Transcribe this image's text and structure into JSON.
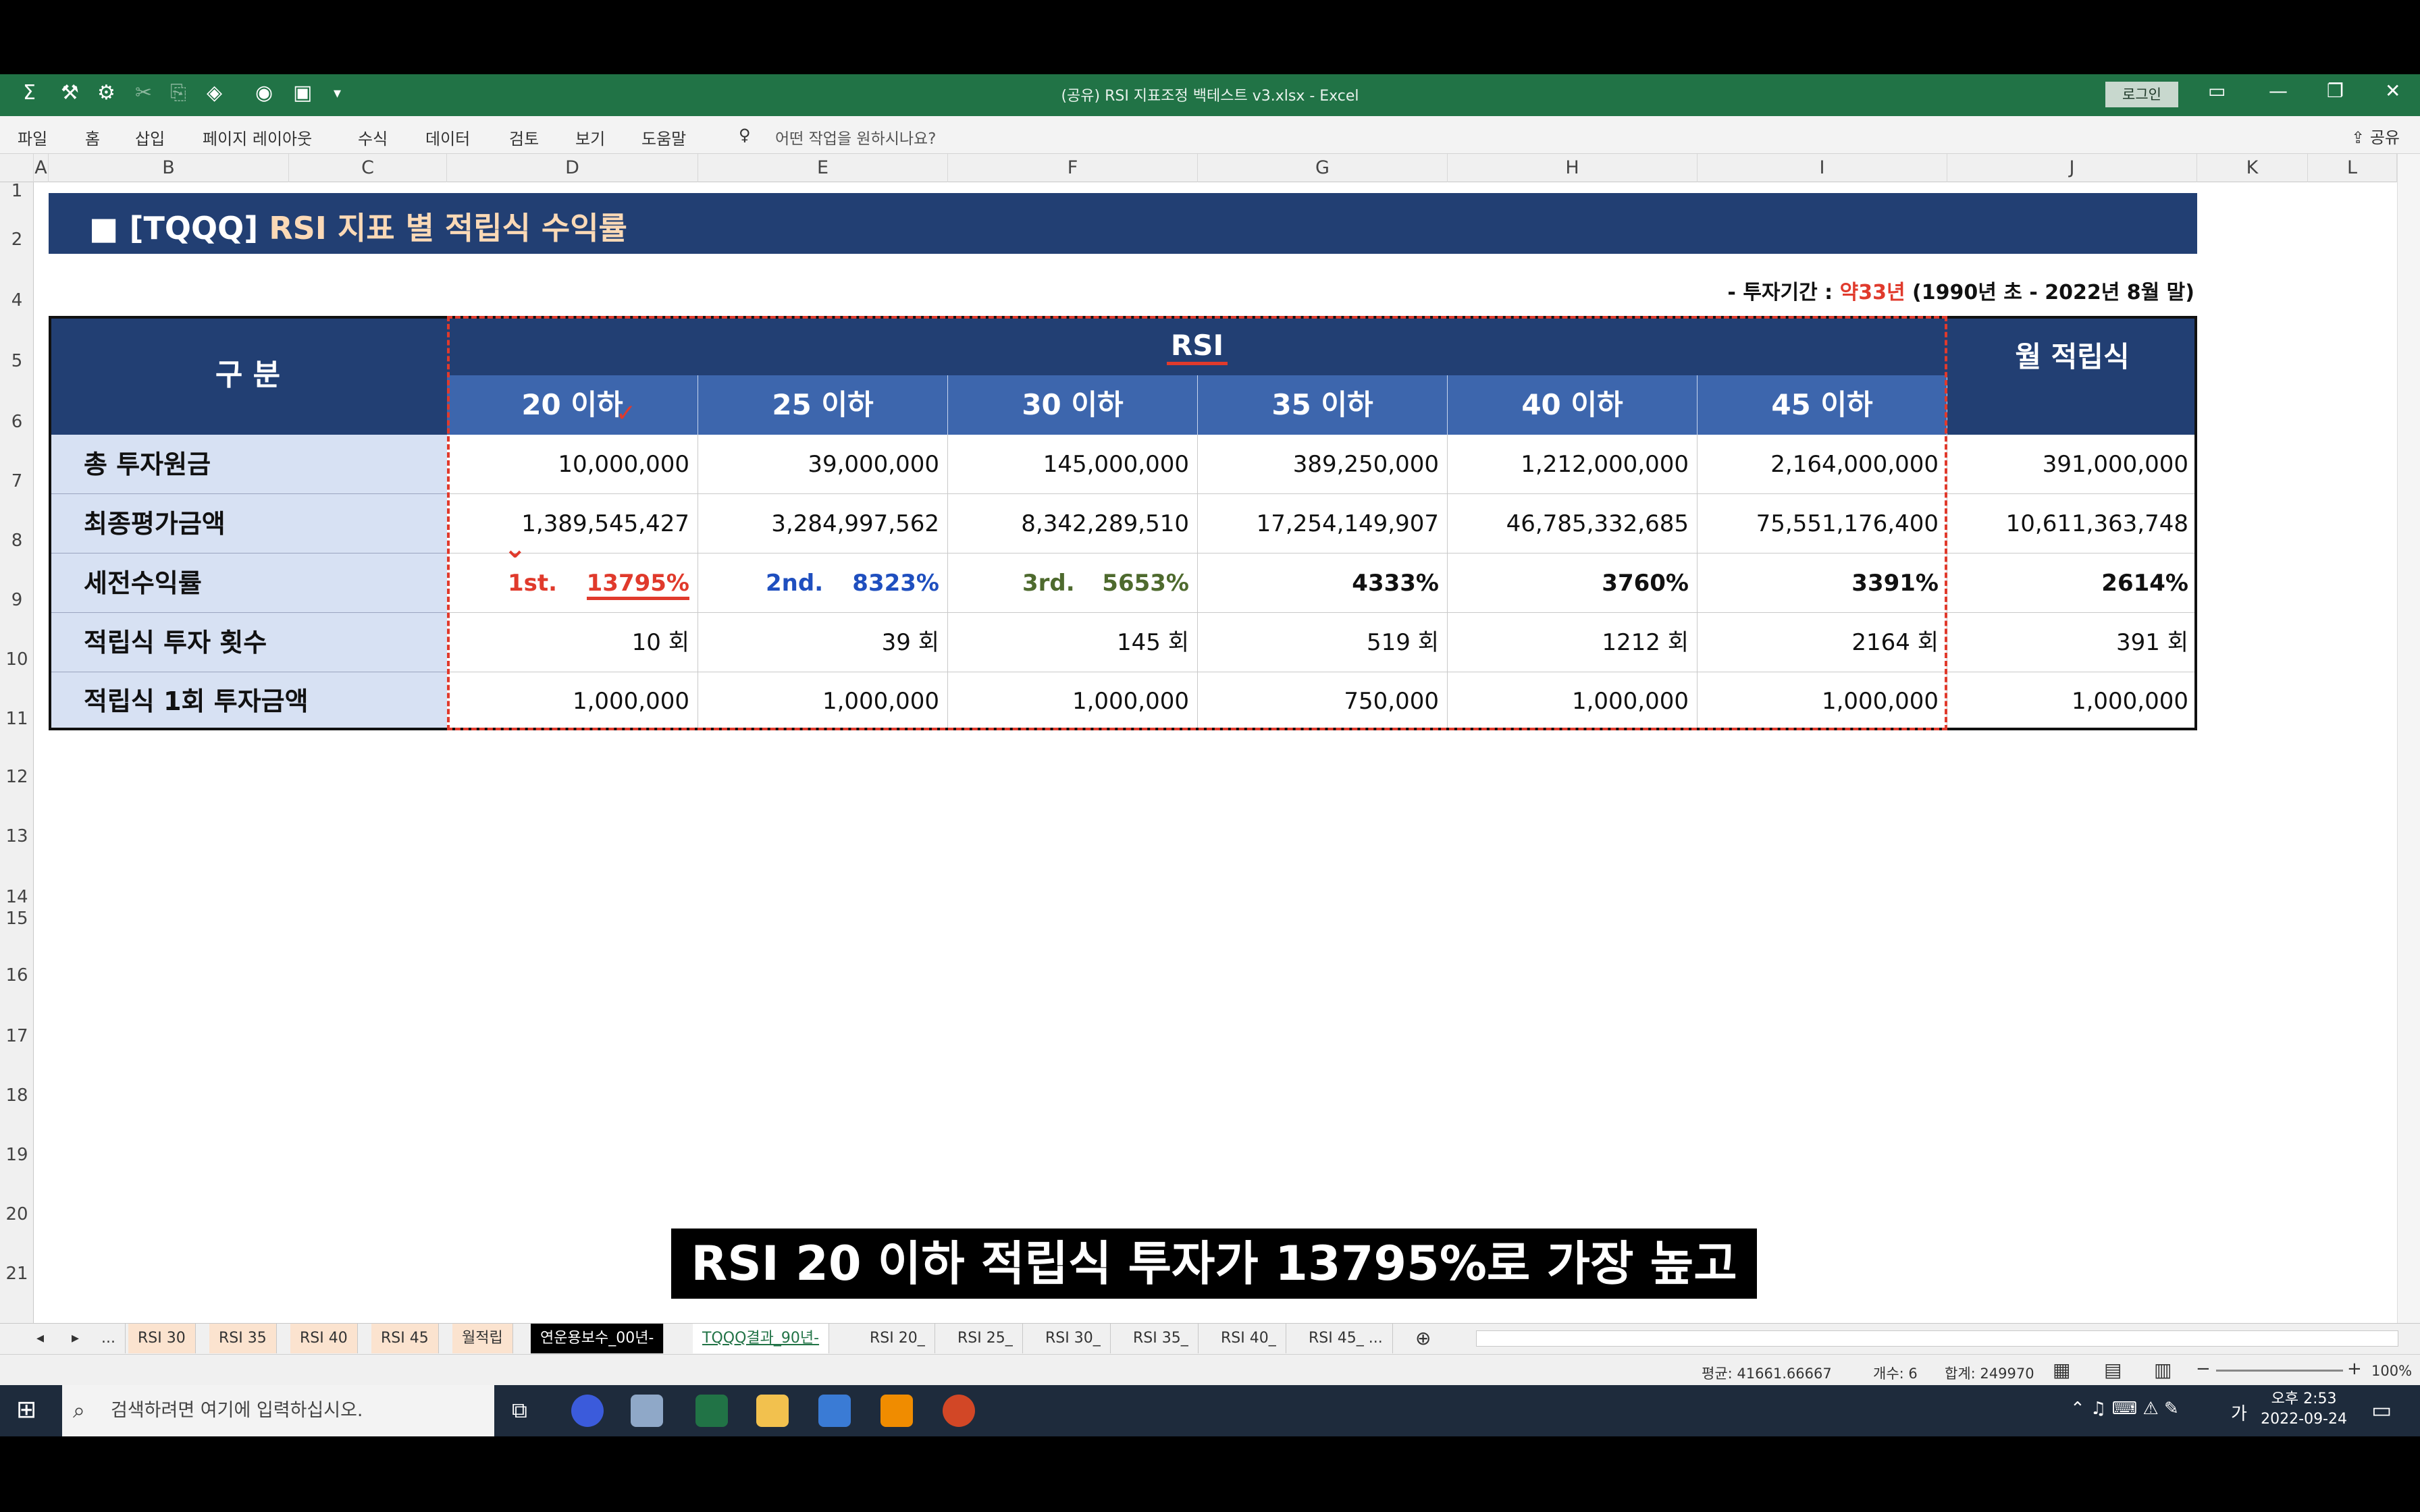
{
  "window": {
    "title": "(공유) RSI 지표조정 백테스트 v3.xlsx  -  Excel",
    "login": "로그인"
  },
  "ribbon": {
    "tabs": [
      "파일",
      "홈",
      "삽입",
      "페이지 레이아웃",
      "수식",
      "데이터",
      "검토",
      "보기",
      "도움말"
    ],
    "tell_me": "어떤 작업을 원하시나요?",
    "share": "공유"
  },
  "columns": [
    "A",
    "B",
    "C",
    "D",
    "E",
    "F",
    "G",
    "H",
    "I",
    "J",
    "K",
    "L"
  ],
  "rows": [
    "1",
    "2",
    "4",
    "5",
    "6",
    "7",
    "8",
    "9",
    "10",
    "11",
    "12",
    "13",
    "14",
    "15",
    "16",
    "17",
    "18",
    "19",
    "20",
    "21"
  ],
  "sheet": {
    "banner_prefix": "■",
    "banner_ticker": "[TQQQ]",
    "banner_title": "RSI 지표 별 적립식 수익률",
    "period_prefix": "- 투자기간 :",
    "period_highlight": "약33년",
    "period_suffix": "(1990년 초 - 2022년 8월 말)",
    "category_header": "구 분",
    "rsi_header": "RSI",
    "monthly_header": "월 적립식",
    "rsi_columns": [
      "20 이하",
      "25 이하",
      "30 이하",
      "35 이하",
      "40 이하",
      "45 이하"
    ],
    "table": [
      {
        "label": "총 투자원금",
        "values": [
          "10,000,000",
          "39,000,000",
          "145,000,000",
          "389,250,000",
          "1,212,000,000",
          "2,164,000,000",
          "391,000,000"
        ]
      },
      {
        "label": "최종평가금액",
        "values": [
          "1,389,545,427",
          "3,284,997,562",
          "8,342,289,510",
          "17,254,149,907",
          "46,785,332,685",
          "75,551,176,400",
          "10,611,363,748"
        ]
      },
      {
        "label": "세전수익률",
        "values": [
          "13795%",
          "8323%",
          "5653%",
          "4333%",
          "3760%",
          "3391%",
          "2614%"
        ],
        "ranks": [
          "1st.",
          "2nd.",
          "3rd."
        ]
      },
      {
        "label": "적립식 투자 횟수",
        "values": [
          "10 회",
          "39 회",
          "145 회",
          "519 회",
          "1212 회",
          "2164 회",
          "391 회"
        ]
      },
      {
        "label": "적립식 1회 투자금액",
        "values": [
          "1,000,000",
          "1,000,000",
          "1,000,000",
          "750,000",
          "1,000,000",
          "1,000,000",
          "1,000,000"
        ]
      }
    ]
  },
  "subtitle": "RSI 20 이하 적립식 투자가 13795%로 가장 높고",
  "sheet_tabs": [
    "...",
    "RSI 30",
    "RSI 35",
    "RSI 40",
    "RSI 45",
    "월적립",
    "연운용보수_00년-",
    "TQQQ결과_90년-",
    "RSI 20_",
    "RSI 25_",
    "RSI 30_",
    "RSI 35_",
    "RSI 40_",
    "RSI 45_ ..."
  ],
  "status": {
    "average": "평균: 41661.66667",
    "count": "개수: 6",
    "sum": "합계: 249970",
    "zoom": "100%"
  },
  "taskbar": {
    "search_placeholder": "검색하려면 여기에 입력하십시오.",
    "time": "오후 2:53",
    "date": "2022-09-24",
    "ime": "가"
  },
  "colors": {
    "excel_green": "#217346",
    "header_navy": "#223f73",
    "subheader_blue": "#3d66ad",
    "label_bg": "#d7e1f3",
    "rank1": "#e03a2c",
    "rank2": "#1f4fbf",
    "rank3": "#4e6a2e"
  }
}
